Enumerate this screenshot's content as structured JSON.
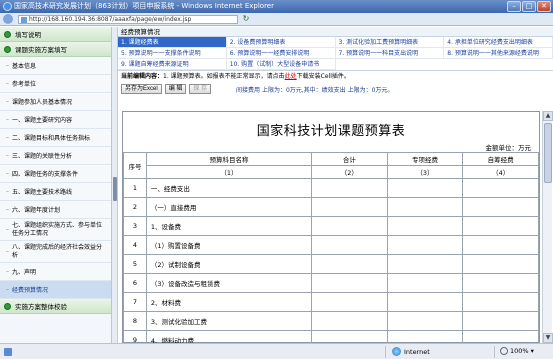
{
  "window": {
    "title": "国家高技术研究发展计划（863计划）项目申报系统 - Windows Internet Explorer",
    "address": "http://168.160.194.36:8087/aaaxfa/page/ew/index.jsp"
  },
  "leftnav": {
    "section_top": "填写说明",
    "section_proposal": "课题实施方案填写",
    "items": [
      "基本信息",
      "参考单位",
      "课题参加人员基本情况",
      "一、课题主要研究内容",
      "二、课题目标和具体任务指标",
      "三、课题的关联性分析",
      "四、课题任务的支撑条件",
      "五、课题主要技术路线",
      "六、课题年度计划",
      "七、课题组织实施方式、参与单位任务分工情况",
      "八、课题完成后的经济社会效益分析",
      "九、声明",
      "经费预算情况"
    ],
    "section_bottom": "实施方案整体校验"
  },
  "main": {
    "panel_title": "经费预算情况",
    "tabs": [
      "1. 课题经费表",
      "2. 设备费预算明细表",
      "3. 测试化验加工费预算明细表",
      "4. 承担单位研究经费支出明细表",
      "5. 预算说明一一支撑条件说明",
      "6. 预算说明一一经费安排说明",
      "7. 预算说明一一科目支出说明",
      "8. 预算说明一一其他来源经费说明",
      "9. 课题自筹经费来源证明",
      "10. 购置（试制）大型设备申请书"
    ],
    "info": {
      "prefix": "当前编辑内容：",
      "text": "1. 课题预算表。如报表不能正常显示，请点击",
      "link": "此处",
      "suffix": "下载安装Cell插件。"
    },
    "toolbar": {
      "export": "另存为Excel",
      "edit": "编 辑",
      "save": "保 存",
      "meta": "间接费用 上限为：0万元,其中：绩效支出 上限为：0万元。"
    },
    "sheet": {
      "title": "国家科技计划课题预算表",
      "unit": "金额单位：万元",
      "headers": {
        "seq": "序号",
        "name": "预算科目名称",
        "total": "合计",
        "special": "专项经费",
        "self": "自筹经费"
      },
      "subheaders": [
        "（1）",
        "（2）",
        "（3）",
        "（4）"
      ],
      "rows": [
        {
          "idx": "1",
          "name": "一、经费支出"
        },
        {
          "idx": "2",
          "name": "（一）直接费用"
        },
        {
          "idx": "3",
          "name": "1、设备费"
        },
        {
          "idx": "4",
          "name": "（1）购置设备费"
        },
        {
          "idx": "5",
          "name": "（2）试制设备费"
        },
        {
          "idx": "6",
          "name": "（3）设备改造与租赁费"
        },
        {
          "idx": "7",
          "name": "2、材料费"
        },
        {
          "idx": "8",
          "name": "3、测试化验加工费"
        },
        {
          "idx": "9",
          "name": "4、燃料动力费"
        }
      ]
    }
  },
  "statusbar": {
    "zone": "Internet",
    "zoom": "100%"
  }
}
